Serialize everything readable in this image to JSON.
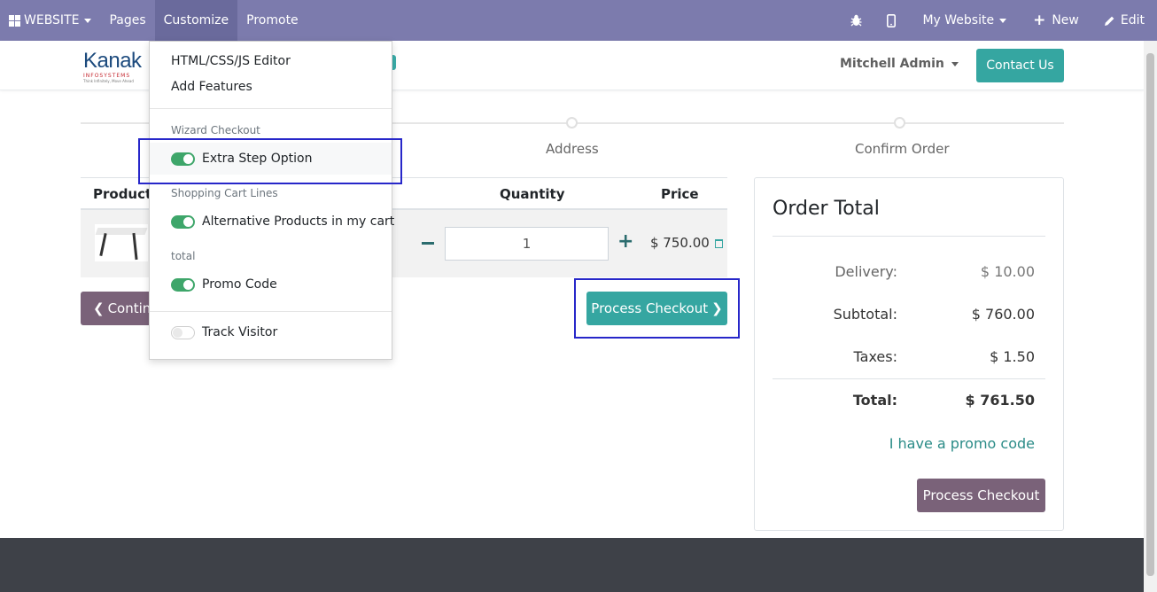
{
  "topbar": {
    "website": "WEBSITE",
    "pages": "Pages",
    "customize": "Customize",
    "promote": "Promote",
    "my_website": "My Website",
    "new": "New",
    "edit": "Edit"
  },
  "header": {
    "logo_main": "Kanak",
    "logo_sub": "INFOSYSTEMS",
    "logo_tag": "Think Infinitely, Move Ahead",
    "user": "Mitchell Admin",
    "contact": "Contact Us"
  },
  "wizard": {
    "steps": [
      "Address",
      "Confirm Order"
    ]
  },
  "cart": {
    "headers": {
      "product": "Product",
      "quantity": "Quantity",
      "price": "Price"
    },
    "row": {
      "quantity": "1",
      "price": "$ 750.00"
    },
    "continue_label": "Continu",
    "process_label": "Process Checkout"
  },
  "order": {
    "title": "Order Total",
    "rows": [
      {
        "label": "Delivery:",
        "value": "$ 10.00"
      },
      {
        "label": "Subtotal:",
        "value": "$ 760.00"
      },
      {
        "label": "Taxes:",
        "value": "$ 1.50"
      }
    ],
    "total_label": "Total:",
    "total_value": "$ 761.50",
    "promo": "I have a promo code",
    "button": "Process Checkout"
  },
  "customize_menu": {
    "html_editor": "HTML/CSS/JS Editor",
    "add_features": "Add Features",
    "section_wizard": "Wizard Checkout",
    "extra_step": "Extra Step Option",
    "section_cart": "Shopping Cart Lines",
    "alt_products": "Alternative Products in my cart",
    "section_total": "total",
    "promo_code": "Promo Code",
    "track_visitor": "Track Visitor",
    "toggles": {
      "extra_step": true,
      "alt_products": true,
      "promo_code": true,
      "track_visitor": false
    }
  },
  "colors": {
    "navbar": "#7c7bad",
    "teal": "#35a6a1",
    "mauve": "#7a6279",
    "toggle_on": "#3ea66a",
    "highlight": "#2727c9"
  }
}
